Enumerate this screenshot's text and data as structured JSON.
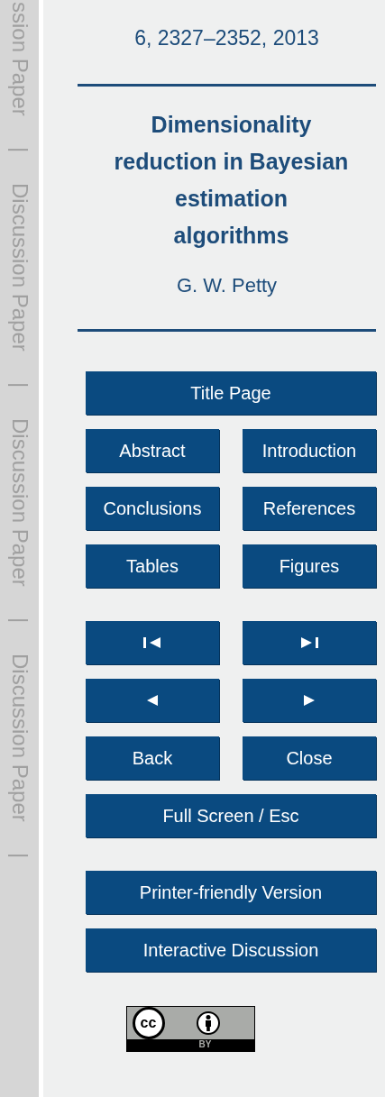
{
  "margin_labels": [
    "ssion Paper",
    "|",
    "Discussion Paper",
    "|",
    "Discussion Paper",
    "|",
    "Discussion Paper",
    "|"
  ],
  "journal_ref": "6, 2327–2352, 2013",
  "title_lines": [
    "Dimensionality",
    "reduction in Bayesian",
    "estimation",
    "algorithms"
  ],
  "author": "G. W. Petty",
  "button_groups": [
    [
      [
        {
          "kind": "text",
          "label": "Title Page"
        }
      ],
      [
        {
          "kind": "text",
          "label": "Abstract"
        },
        {
          "kind": "text",
          "label": "Introduction"
        }
      ],
      [
        {
          "kind": "text",
          "label": "Conclusions"
        },
        {
          "kind": "text",
          "label": "References"
        }
      ],
      [
        {
          "kind": "text",
          "label": "Tables"
        },
        {
          "kind": "text",
          "label": "Figures"
        }
      ]
    ],
    [
      [
        {
          "kind": "first"
        },
        {
          "kind": "last"
        }
      ],
      [
        {
          "kind": "previous"
        },
        {
          "kind": "next"
        }
      ],
      [
        {
          "kind": "text",
          "label": "Back"
        },
        {
          "kind": "text",
          "label": "Close"
        }
      ],
      [
        {
          "kind": "text",
          "label": "Full Screen / Esc"
        }
      ]
    ],
    [
      [
        {
          "kind": "text",
          "label": "Printer-friendly Version"
        }
      ],
      [
        {
          "kind": "text",
          "label": "Interactive Discussion"
        }
      ]
    ]
  ],
  "license": {
    "cc_label": "cc",
    "by_label": "BY"
  }
}
